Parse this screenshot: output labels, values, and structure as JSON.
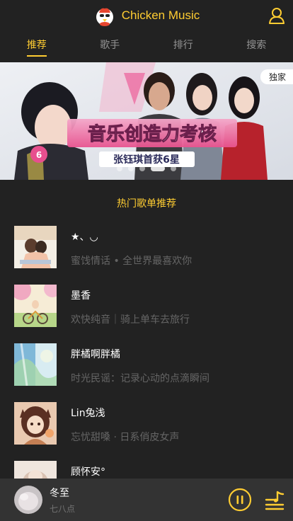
{
  "header": {
    "title": "Chicken Music"
  },
  "tabs": [
    {
      "label": "推荐",
      "active": true
    },
    {
      "label": "歌手",
      "active": false
    },
    {
      "label": "排行",
      "active": false
    },
    {
      "label": "搜索",
      "active": false
    }
  ],
  "banner": {
    "headline": "音乐创造力考核",
    "subline": "张钰琪首获6星",
    "badge": "独家",
    "slide_count": 5,
    "active_slide": 4
  },
  "section": {
    "title": "热门歌单推荐"
  },
  "playlists": [
    {
      "name": "★、◡",
      "desc": "蜜饯情话 • 全世界最喜欢你"
    },
    {
      "name": "墨香",
      "desc": "欢快纯音｜骑上单车去旅行"
    },
    {
      "name": "胖橘啊胖橘",
      "desc": "时光民谣：记录心动的点滴瞬间"
    },
    {
      "name": "Lin兔浅",
      "desc": "忘忧甜嗓 · 日系俏皮女声"
    },
    {
      "name": "顾怀安°",
      "desc": ""
    }
  ],
  "player": {
    "song": "冬至",
    "singer": "七八点",
    "state": "playing"
  },
  "colors": {
    "accent": "#ffcd32",
    "background": "#222222",
    "player_bg": "#333333"
  },
  "icons": {
    "user": "user-icon",
    "pause": "pause-icon",
    "playlist": "playlist-icon"
  }
}
